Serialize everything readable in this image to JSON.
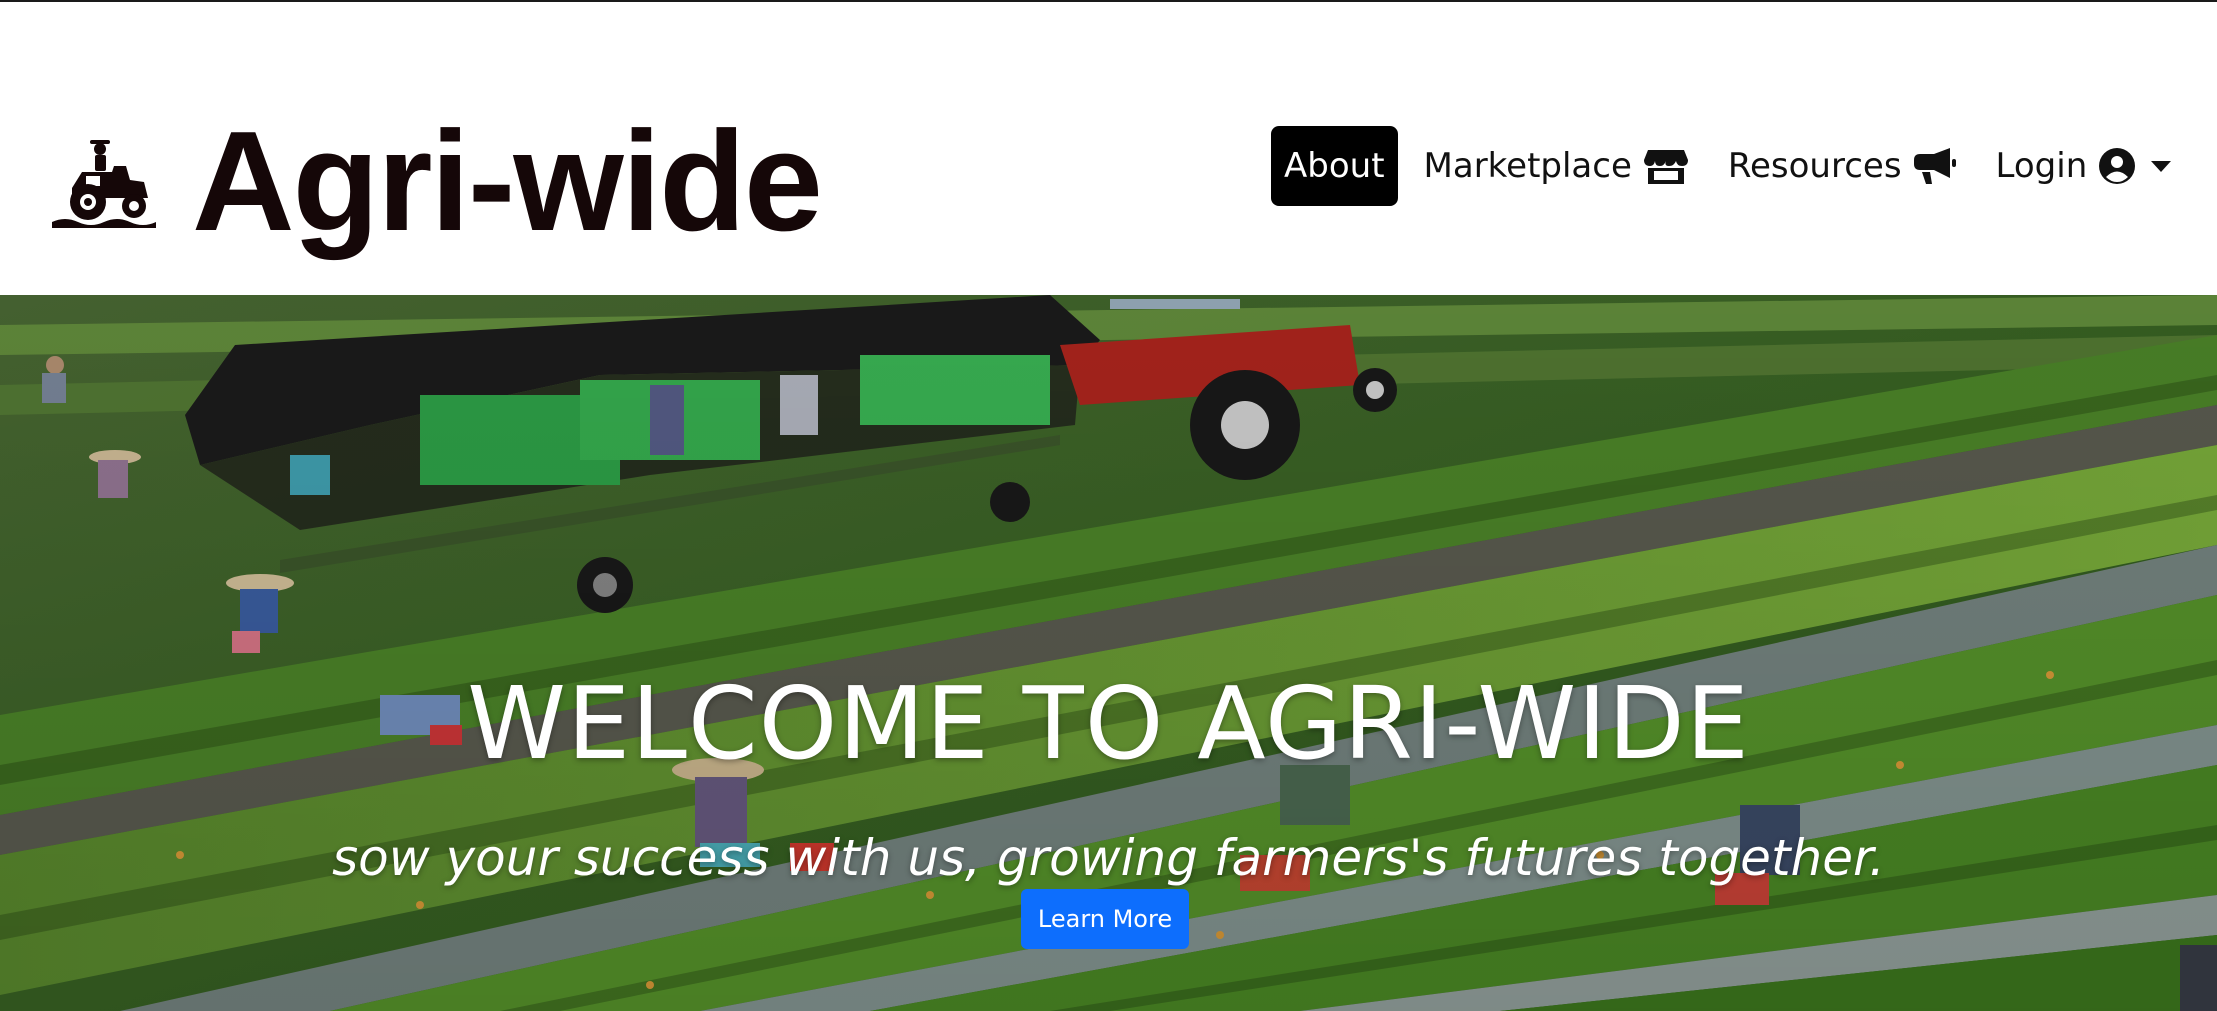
{
  "brand": {
    "name": "Agri-wide",
    "logo_icon": "tractor-farmer-icon",
    "text_color": "#150708"
  },
  "nav": {
    "items": [
      {
        "label": "About",
        "icon": null,
        "active": true
      },
      {
        "label": "Marketplace",
        "icon": "store-icon",
        "active": false
      },
      {
        "label": "Resources",
        "icon": "megaphone-icon",
        "active": false
      },
      {
        "label": "Login",
        "icon": "user-circle-icon",
        "active": false,
        "dropdown": true
      }
    ]
  },
  "hero": {
    "title": "WELCOME TO AGRI-WIDE",
    "subtitle": "sow your success with us, growing farmers's futures together.",
    "cta_label": "Learn More",
    "cta_color": "#0d6efd"
  },
  "colors": {
    "active_nav_bg": "#000000",
    "active_nav_text": "#ffffff"
  }
}
